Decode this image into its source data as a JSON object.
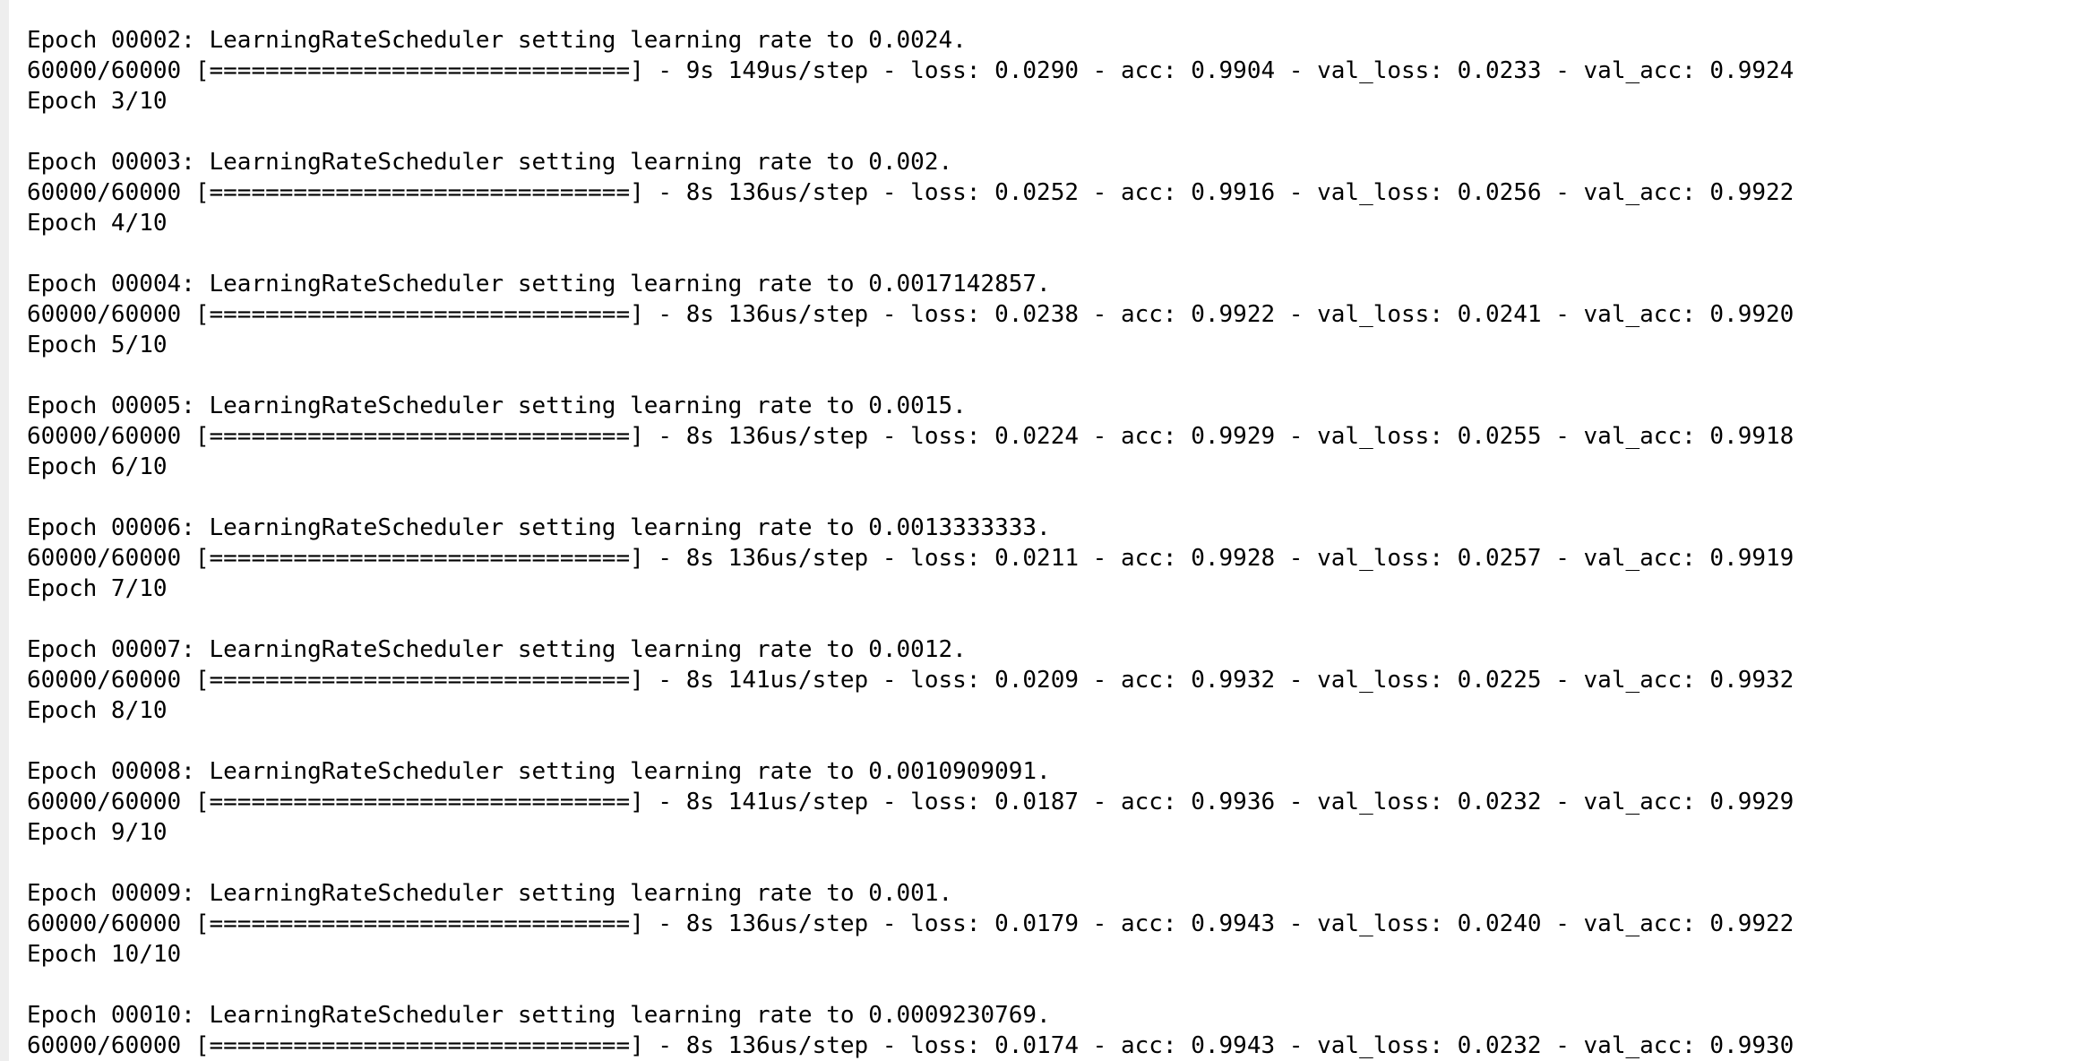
{
  "output": {
    "lines": [
      "Epoch 00002: LearningRateScheduler setting learning rate to 0.0024.",
      "60000/60000 [==============================] - 9s 149us/step - loss: 0.0290 - acc: 0.9904 - val_loss: 0.0233 - val_acc: 0.9924",
      "Epoch 3/10",
      "",
      "Epoch 00003: LearningRateScheduler setting learning rate to 0.002.",
      "60000/60000 [==============================] - 8s 136us/step - loss: 0.0252 - acc: 0.9916 - val_loss: 0.0256 - val_acc: 0.9922",
      "Epoch 4/10",
      "",
      "Epoch 00004: LearningRateScheduler setting learning rate to 0.0017142857.",
      "60000/60000 [==============================] - 8s 136us/step - loss: 0.0238 - acc: 0.9922 - val_loss: 0.0241 - val_acc: 0.9920",
      "Epoch 5/10",
      "",
      "Epoch 00005: LearningRateScheduler setting learning rate to 0.0015.",
      "60000/60000 [==============================] - 8s 136us/step - loss: 0.0224 - acc: 0.9929 - val_loss: 0.0255 - val_acc: 0.9918",
      "Epoch 6/10",
      "",
      "Epoch 00006: LearningRateScheduler setting learning rate to 0.0013333333.",
      "60000/60000 [==============================] - 8s 136us/step - loss: 0.0211 - acc: 0.9928 - val_loss: 0.0257 - val_acc: 0.9919",
      "Epoch 7/10",
      "",
      "Epoch 00007: LearningRateScheduler setting learning rate to 0.0012.",
      "60000/60000 [==============================] - 8s 141us/step - loss: 0.0209 - acc: 0.9932 - val_loss: 0.0225 - val_acc: 0.9932",
      "Epoch 8/10",
      "",
      "Epoch 00008: LearningRateScheduler setting learning rate to 0.0010909091.",
      "60000/60000 [==============================] - 8s 141us/step - loss: 0.0187 - acc: 0.9936 - val_loss: 0.0232 - val_acc: 0.9929",
      "Epoch 9/10",
      "",
      "Epoch 00009: LearningRateScheduler setting learning rate to 0.001.",
      "60000/60000 [==============================] - 8s 136us/step - loss: 0.0179 - acc: 0.9943 - val_loss: 0.0240 - val_acc: 0.9922",
      "Epoch 10/10",
      "",
      "Epoch 00010: LearningRateScheduler setting learning rate to 0.0009230769.",
      "60000/60000 [==============================] - 8s 136us/step - loss: 0.0174 - acc: 0.9943 - val_loss: 0.0232 - val_acc: 0.9930"
    ]
  }
}
